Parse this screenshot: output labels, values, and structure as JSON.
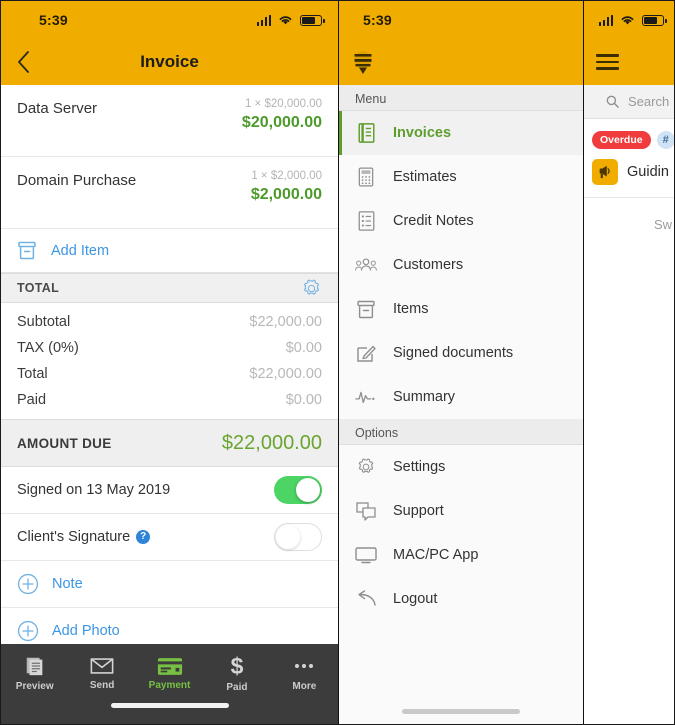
{
  "invoice_screen": {
    "status_bar": {
      "time": "5:39",
      "signal_icon": "signal-bars-icon",
      "wifi_icon": "wifi-icon",
      "battery_icon": "battery-icon"
    },
    "nav": {
      "back_icon": "chevron-left-icon",
      "title": "Invoice"
    },
    "line_items": [
      {
        "name": "Data Server",
        "qty_price": "1 × $20,000.00",
        "amount": "$20,000.00"
      },
      {
        "name": "Domain Purchase",
        "qty_price": "1 × $2,000.00",
        "amount": "$2,000.00"
      }
    ],
    "add_item": {
      "label": "Add Item",
      "icon": "box-icon"
    },
    "total_section": {
      "header": "TOTAL",
      "settings_icon": "gear-icon",
      "lines": [
        {
          "label": "Subtotal",
          "value": "$22,000.00"
        },
        {
          "label": "TAX (0%)",
          "value": "$0.00"
        },
        {
          "label": "Total",
          "value": "$22,000.00"
        },
        {
          "label": "Paid",
          "value": "$0.00"
        }
      ]
    },
    "amount_due": {
      "label": "AMOUNT DUE",
      "value": "$22,000.00"
    },
    "toggles": [
      {
        "label": "Signed on 13 May 2019",
        "state": "on",
        "has_help": false
      },
      {
        "label": "Client's Signature",
        "state": "off",
        "has_help": true,
        "help_glyph": "?"
      }
    ],
    "actions": [
      {
        "label": "Note",
        "icon": "plus-circle-icon"
      },
      {
        "label": "Add Photo",
        "icon": "plus-circle-icon"
      }
    ],
    "tab_bar": {
      "active": "Payment",
      "tabs": [
        {
          "label": "Preview",
          "icon": "document-icon"
        },
        {
          "label": "Send",
          "icon": "envelope-icon"
        },
        {
          "label": "Payment",
          "icon": "credit-card-icon"
        },
        {
          "label": "Paid",
          "icon": "dollar-icon"
        },
        {
          "label": "More",
          "icon": "ellipsis-icon"
        }
      ]
    }
  },
  "menu_screen": {
    "status_bar": {
      "time": "5:39"
    },
    "logo_icon": "bee-logo-icon",
    "groups": [
      {
        "header": "Menu",
        "items": [
          {
            "label": "Invoices",
            "icon": "invoice-doc-icon",
            "active": true
          },
          {
            "label": "Estimates",
            "icon": "calculator-icon",
            "active": false
          },
          {
            "label": "Credit Notes",
            "icon": "list-doc-icon",
            "active": false
          },
          {
            "label": "Customers",
            "icon": "people-icon",
            "active": false
          },
          {
            "label": "Items",
            "icon": "box-icon",
            "active": false
          },
          {
            "label": "Signed documents",
            "icon": "signed-doc-icon",
            "active": false
          },
          {
            "label": "Summary",
            "icon": "pulse-chart-icon",
            "active": false
          }
        ]
      },
      {
        "header": "Options",
        "items": [
          {
            "label": "Settings",
            "icon": "gear-icon",
            "active": false
          },
          {
            "label": "Support",
            "icon": "chat-bubbles-icon",
            "active": false
          },
          {
            "label": "MAC/PC App",
            "icon": "monitor-icon",
            "active": false
          },
          {
            "label": "Logout",
            "icon": "arrow-exit-icon",
            "active": false
          }
        ]
      }
    ]
  },
  "list_screen": {
    "menu_icon": "hamburger-menu-icon",
    "search": {
      "icon": "search-icon",
      "placeholder": "Search"
    },
    "card": {
      "status_badge": "Overdue",
      "number_badge": "#",
      "client_icon": "megaphone-icon",
      "client_name": "Guidin"
    },
    "footer_text": "Sw"
  },
  "colors": {
    "brand_yellow": "#f0ad00",
    "accent_green": "#4c9a2a",
    "link_blue": "#3d96e3",
    "overdue_red": "#f03c3c",
    "tabbar_dark": "#3c3c3c",
    "toggle_on_green": "#4cd464"
  }
}
